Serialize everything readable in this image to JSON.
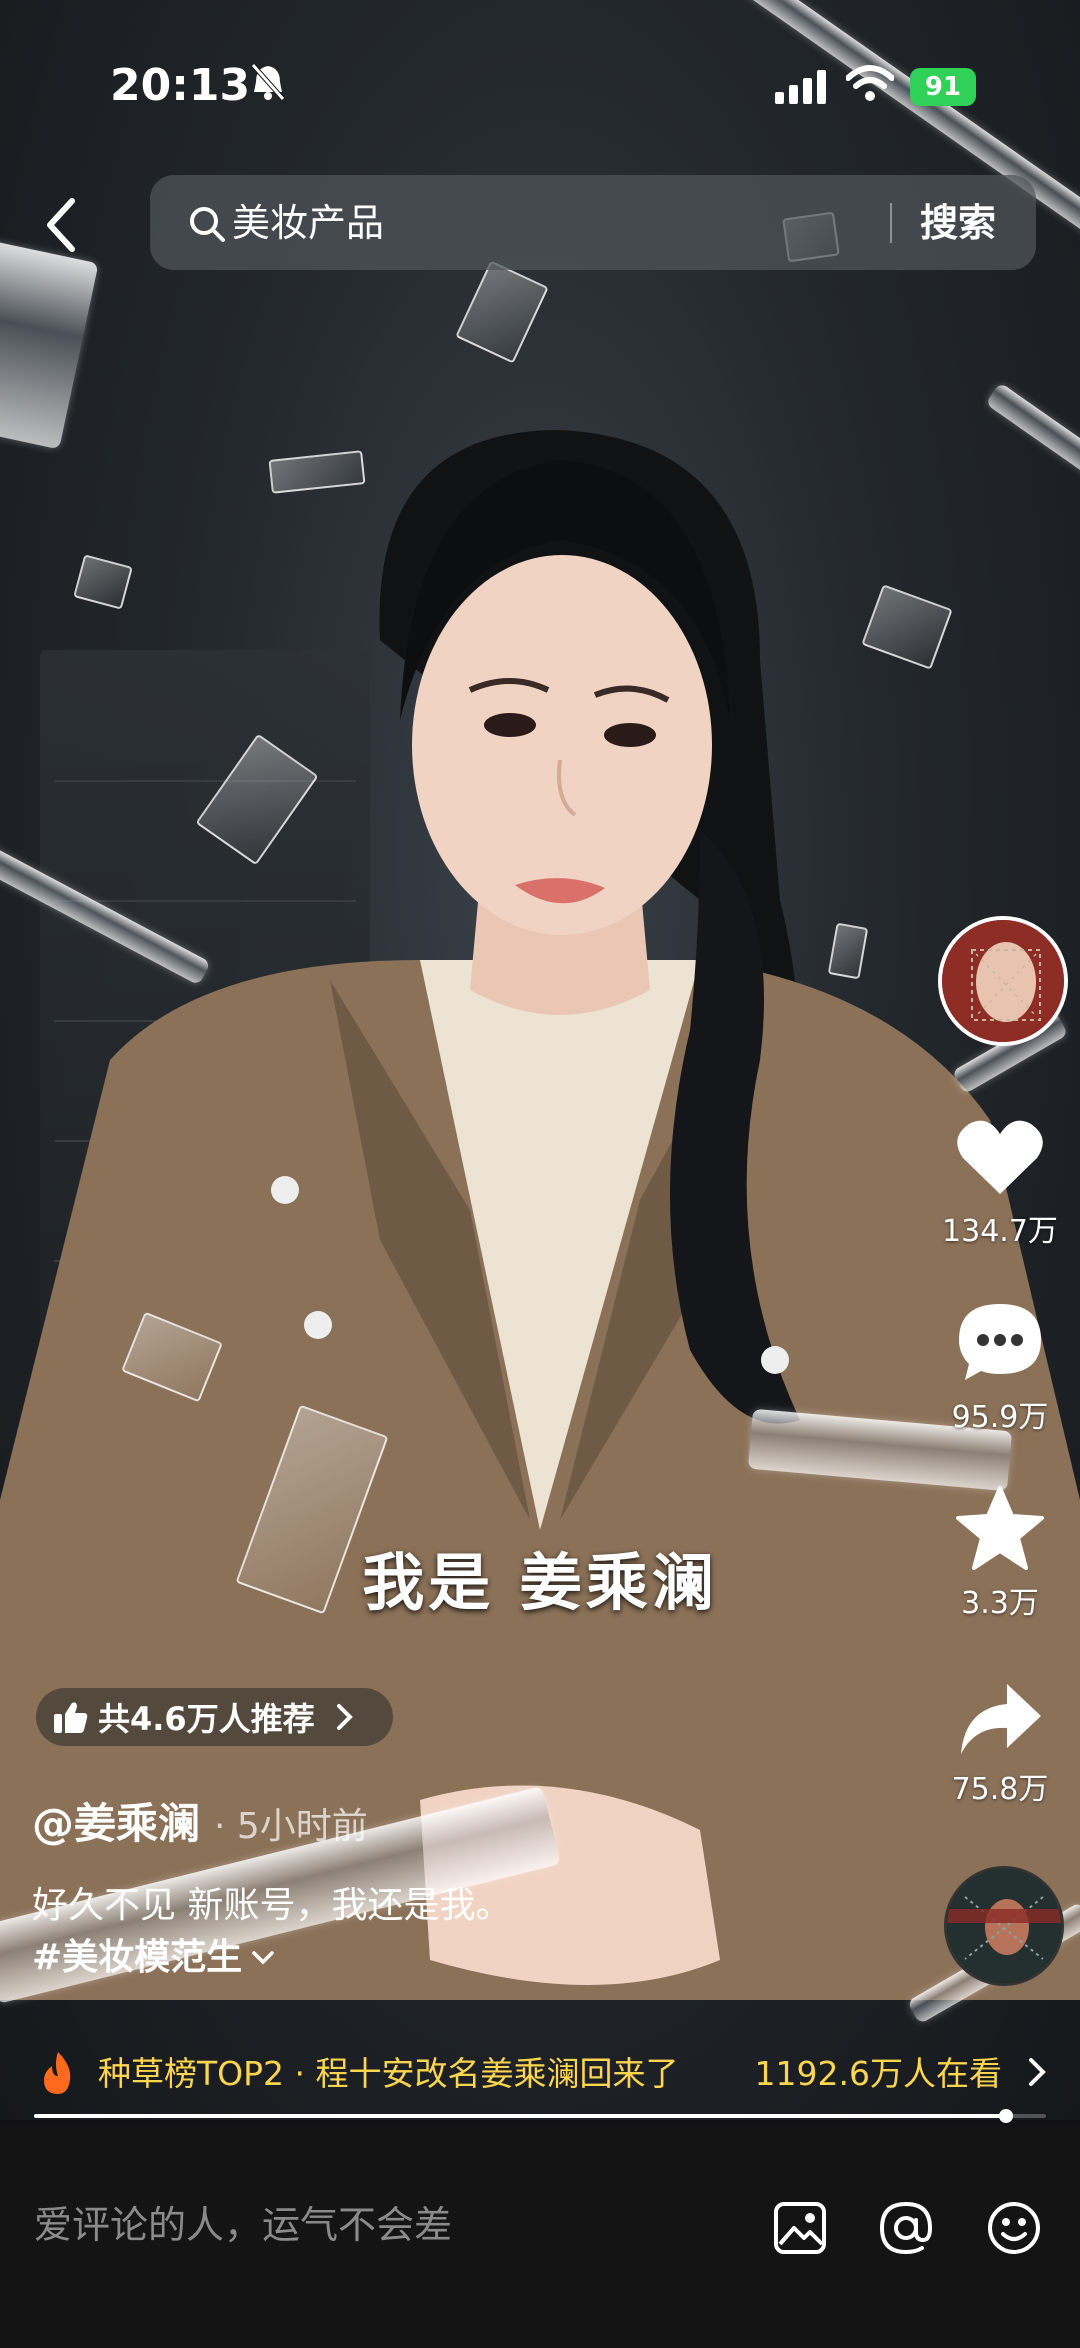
{
  "status_bar": {
    "time": "20:13",
    "battery": "91"
  },
  "search": {
    "placeholder": "美妆产品",
    "button": "搜索"
  },
  "subtitle": "我是 姜乘澜",
  "recommend": {
    "label": "共4.6万人推荐"
  },
  "post": {
    "author": "@姜乘澜",
    "time": "· 5小时前",
    "description": "好久不见 新账号，我还是我。",
    "hashtag": "#美妆模范生"
  },
  "actions": {
    "likes": "134.7万",
    "comments": "95.9万",
    "favorites": "3.3万",
    "shares": "75.8万"
  },
  "hot": {
    "text": "种草榜TOP2 · 程十安改名姜乘澜回来了",
    "viewers": "1192.6万人在看"
  },
  "progress": 0.96,
  "comment_bar": {
    "placeholder": "爱评论的人，运气不会差"
  },
  "colors": {
    "hot": "#fdd54f",
    "battery": "#30d158"
  }
}
